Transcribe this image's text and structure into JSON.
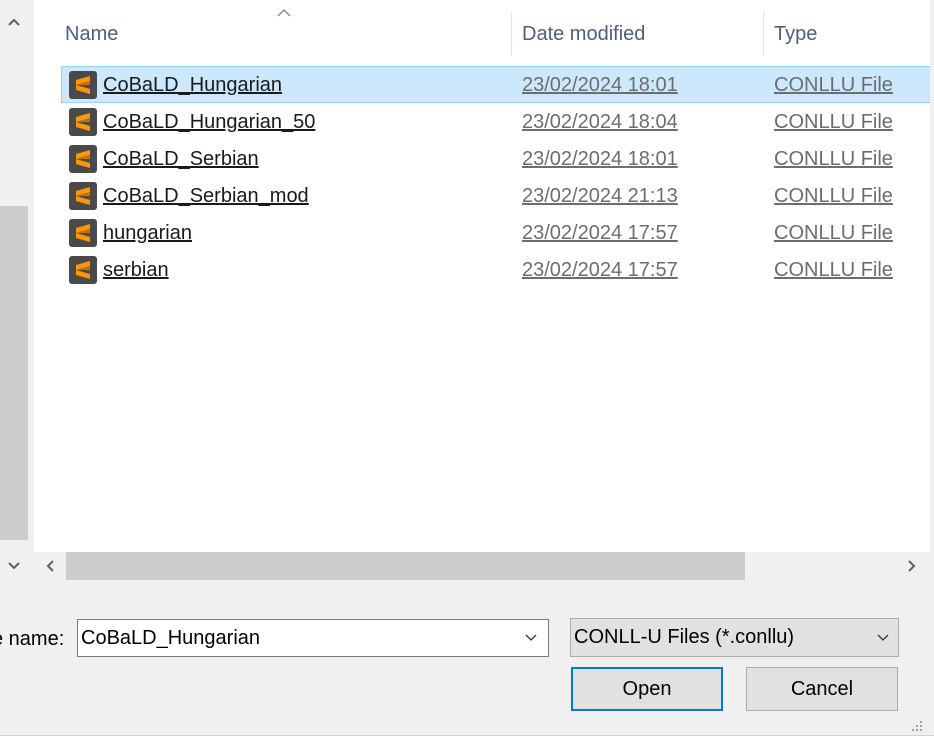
{
  "columns": {
    "name": "Name",
    "date": "Date modified",
    "type": "Type"
  },
  "files": [
    {
      "name": "CoBaLD_Hungarian",
      "date": "23/02/2024 18:01",
      "type": "CONLLU File",
      "selected": true
    },
    {
      "name": "CoBaLD_Hungarian_50",
      "date": "23/02/2024 18:04",
      "type": "CONLLU File",
      "selected": false
    },
    {
      "name": "CoBaLD_Serbian",
      "date": "23/02/2024 18:01",
      "type": "CONLLU File",
      "selected": false
    },
    {
      "name": "CoBaLD_Serbian_mod",
      "date": "23/02/2024 21:13",
      "type": "CONLLU File",
      "selected": false
    },
    {
      "name": "hungarian",
      "date": "23/02/2024 17:57",
      "type": "CONLLU File",
      "selected": false
    },
    {
      "name": "serbian",
      "date": "23/02/2024 17:57",
      "type": "CONLLU File",
      "selected": false
    }
  ],
  "file_icon": "sublime-text-icon",
  "footer": {
    "filename_label": "e name:",
    "filename_value": "CoBaLD_Hungarian",
    "filetype_value": "CONLL-U Files (*.conllu)",
    "open_label": "Open",
    "cancel_label": "Cancel"
  },
  "colors": {
    "selection": "#cce8ff",
    "selection_border": "#99d1ff",
    "accent": "#0078d7",
    "icon_orange": "#ff9800"
  }
}
